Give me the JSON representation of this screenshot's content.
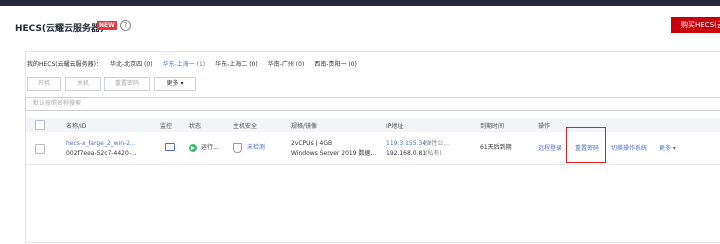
{
  "header": {
    "title": "HECS(云耀云服务器)",
    "new_badge": "NEW",
    "help_icon": "?",
    "buy_button": "购买HECS(云耀"
  },
  "regions": {
    "label": "我的HECS(云耀云服务器)：",
    "items": [
      {
        "label": "华北-北京四 (0)"
      },
      {
        "label": "华东-上海一 (1)",
        "selected": true
      },
      {
        "label": "华东-上海二 (0)"
      },
      {
        "label": "华南-广州 (0)"
      },
      {
        "label": "西南-贵阳一 (0)"
      }
    ]
  },
  "toolbar": {
    "start": "开机",
    "stop": "关机",
    "reset_password": "重置密码",
    "more": "更多 ▾"
  },
  "search": {
    "placeholder": "默认按照名称搜索"
  },
  "table": {
    "columns": [
      "名称/ID",
      "监控",
      "状态",
      "主机安全",
      "规格/镜像",
      "IP地址",
      "到期时间",
      "操作"
    ],
    "row": {
      "name": "hecs-x_large_2_win-2...",
      "id": "002f7eea-52c7-4420-...",
      "status": "运行...",
      "security": "未检测",
      "spec": "2vCPUs | 4GB",
      "image": "Windows Server 2019 数据...",
      "ip_public": "119.3.155.34",
      "ip_public_note": "(弹性公...",
      "ip_private": "192.168.0.81",
      "ip_private_note": "(私有)",
      "expiry": "61天后到期",
      "actions": {
        "remote_login": "远程登录",
        "reset_password": "重置密码",
        "switch_os": "切换操作系统",
        "more": "更多 ▾"
      }
    }
  },
  "colors": {
    "brand_red": "#c7000b",
    "link_blue": "#526ecc",
    "running_green": "#3dbf6e",
    "highlight_red": "#e02020"
  }
}
